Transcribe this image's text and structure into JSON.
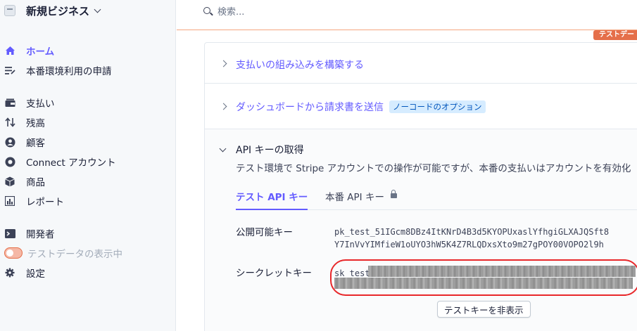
{
  "account": {
    "name": "新規ビジネス"
  },
  "sidebar": {
    "items": [
      {
        "label": "ホーム",
        "icon": "home-icon"
      },
      {
        "label": "本番環境利用の申請",
        "icon": "checklist-icon"
      },
      {
        "label": "支払い",
        "icon": "payments-icon"
      },
      {
        "label": "残高",
        "icon": "balances-icon"
      },
      {
        "label": "顧客",
        "icon": "customers-icon"
      },
      {
        "label": "Connect アカウント",
        "icon": "connect-icon"
      },
      {
        "label": "商品",
        "icon": "products-icon"
      },
      {
        "label": "レポート",
        "icon": "reports-icon"
      },
      {
        "label": "開発者",
        "icon": "terminal-icon"
      },
      {
        "label": "テストデータの表示中",
        "icon": "toggle"
      },
      {
        "label": "設定",
        "icon": "gear-icon"
      }
    ]
  },
  "search": {
    "placeholder": "検索..."
  },
  "test_badge": "テストデー",
  "rows": {
    "integration": "支払いの組み込みを構築する",
    "invoice": "ダッシュボードから請求書を送信",
    "invoice_pill": "ノーコードのオプション"
  },
  "api": {
    "title": "API キーの取得",
    "description": "テスト環境で Stripe アカウントでの操作が可能ですが、本番の支払いはアカウントを有効化",
    "tabs": {
      "test": "テスト API キー",
      "live": "本番 API キー"
    },
    "publishable_label": "公開可能キー",
    "publishable_line1": "pk_test_51IGcm8DBz4ItKNrD4B3d5KYOPUxaslYfhgiGLXAJQSft8",
    "publishable_line2": "Y7InVvYIMfieW1oUYO3hW5K4Z7RLQDxsXto9m27gPOY00VOPO2l9h",
    "secret_label": "シークレットキー",
    "secret_prefix": "sk_test_",
    "hide_button": "テストキーを非表示"
  },
  "colors": {
    "accent": "#635bff",
    "test_mode": "#e56f4a",
    "annotation": "#e8272a"
  }
}
